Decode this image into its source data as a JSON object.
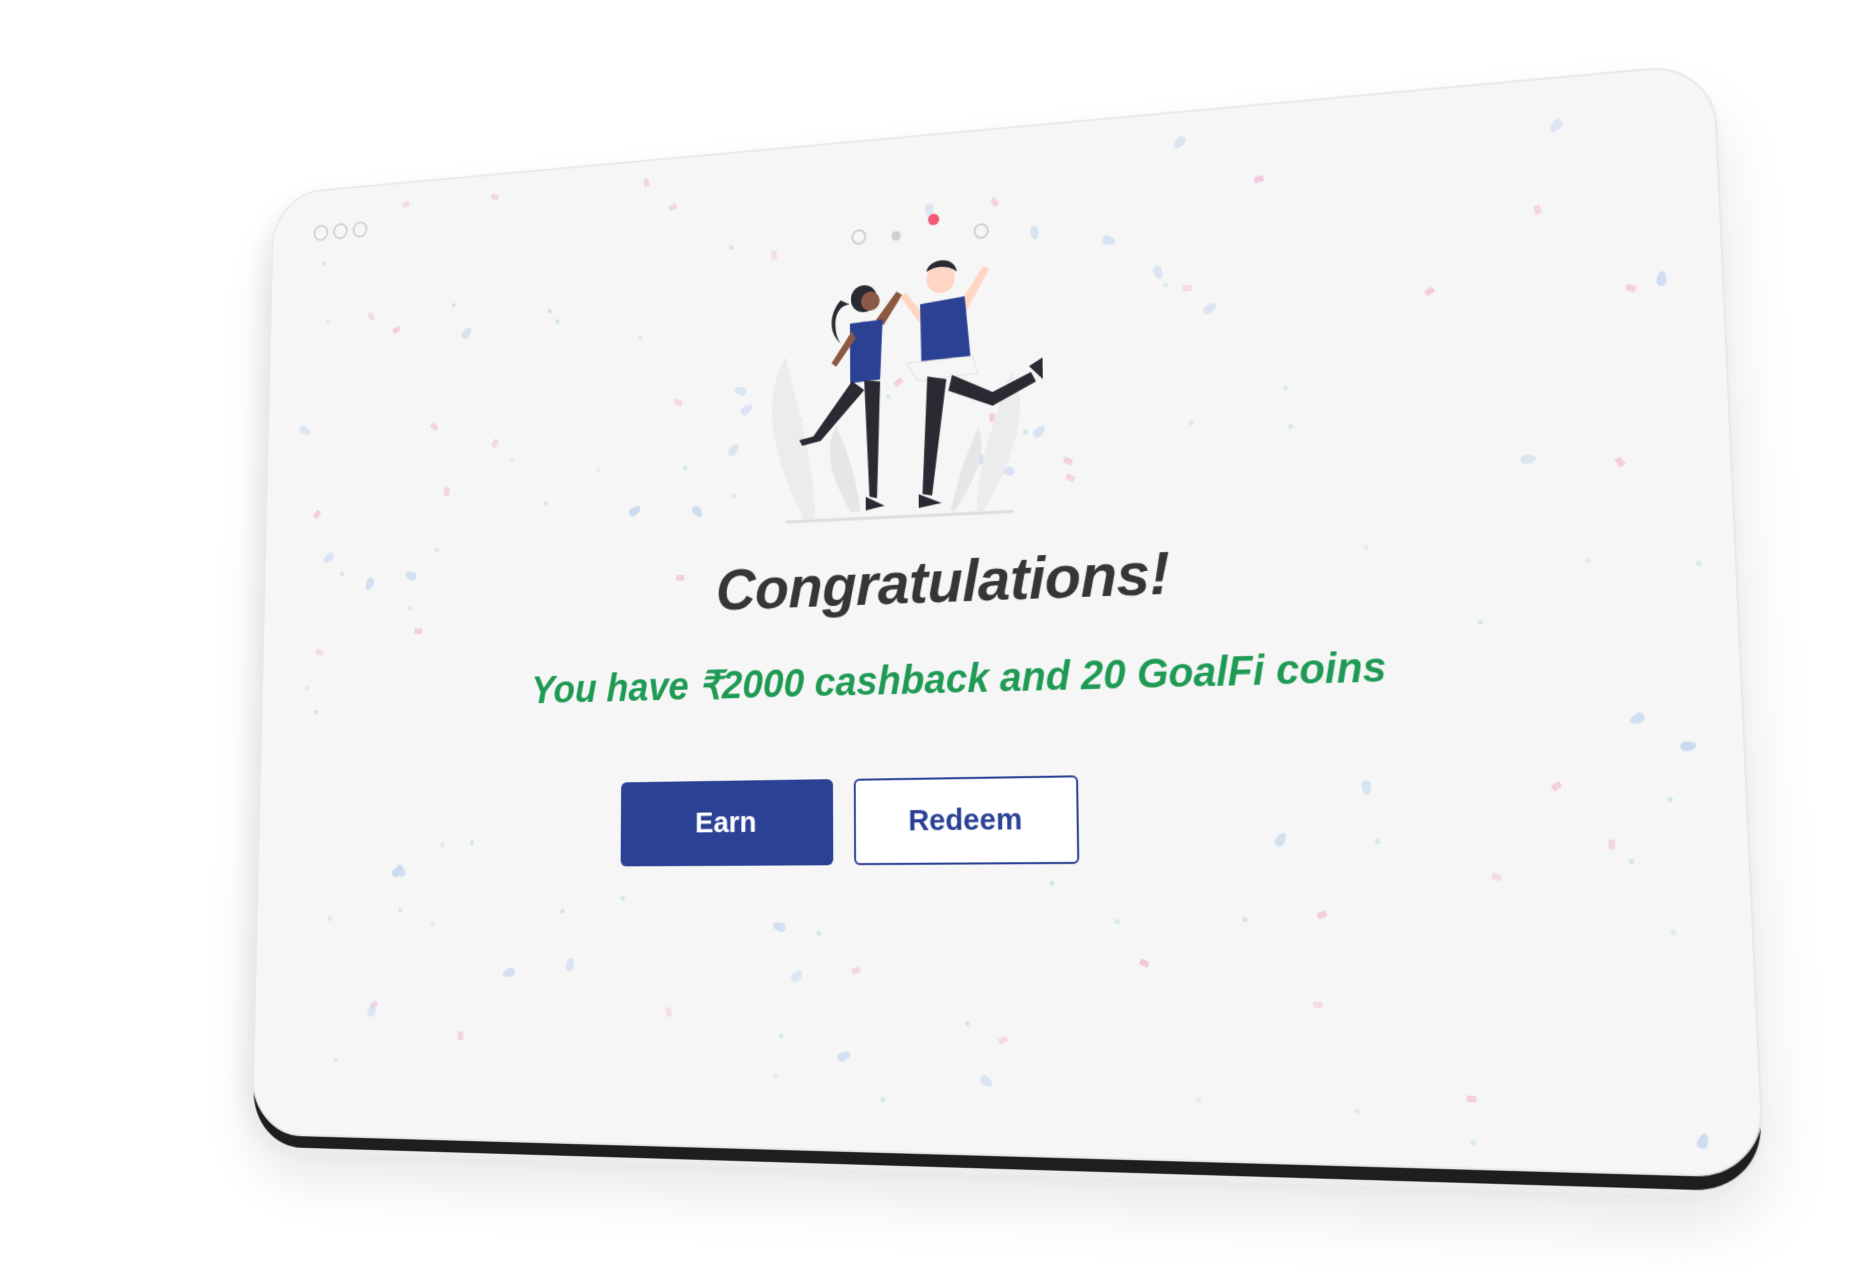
{
  "window": {
    "controls": [
      "window-dot",
      "window-dot",
      "window-dot"
    ]
  },
  "dialog": {
    "title": "Congratulations!",
    "message": "You have ₹2000 cashback and 20 GoalFi coins",
    "illustration": "celebrating-people-illustration"
  },
  "actions": {
    "earn_label": "Earn",
    "redeem_label": "Redeem"
  },
  "colors": {
    "primary": "#2b4194",
    "success": "#1f9a54",
    "title": "#363636",
    "background": "#f6f6f6"
  }
}
